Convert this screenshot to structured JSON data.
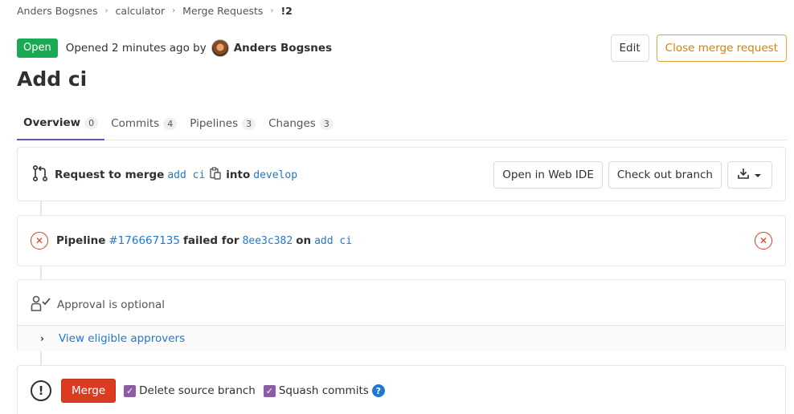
{
  "breadcrumb": {
    "items": [
      "Anders Bogsnes",
      "calculator",
      "Merge Requests",
      "!2"
    ]
  },
  "header": {
    "status": "Open",
    "opened_text": "Opened 2 minutes ago by",
    "author": "Anders Bogsnes",
    "edit_label": "Edit",
    "close_label": "Close merge request",
    "title": "Add ci"
  },
  "tabs": [
    {
      "label": "Overview",
      "count": "0"
    },
    {
      "label": "Commits",
      "count": "4"
    },
    {
      "label": "Pipelines",
      "count": "3"
    },
    {
      "label": "Changes",
      "count": "3"
    }
  ],
  "merge_info": {
    "prefix": "Request to merge",
    "source_branch": "add ci",
    "into": "into",
    "target_branch": "develop",
    "web_ide_label": "Open in Web IDE",
    "checkout_label": "Check out branch"
  },
  "pipeline": {
    "label": "Pipeline",
    "id": "#176667135",
    "status": "failed for",
    "commit": "8ee3c382",
    "on": "on",
    "branch": "add ci"
  },
  "approval": {
    "text": "Approval is optional",
    "view_approvers": "View eligible approvers"
  },
  "merge": {
    "button": "Merge",
    "delete_source": "Delete source branch",
    "squash": "Squash commits"
  },
  "colors": {
    "open_badge": "#1aaa55",
    "link": "#1f78d1",
    "danger": "#db3b21",
    "warning": "#e9a33c",
    "checkbox": "#8e5ca4",
    "active_tab": "#6b4fbb"
  }
}
